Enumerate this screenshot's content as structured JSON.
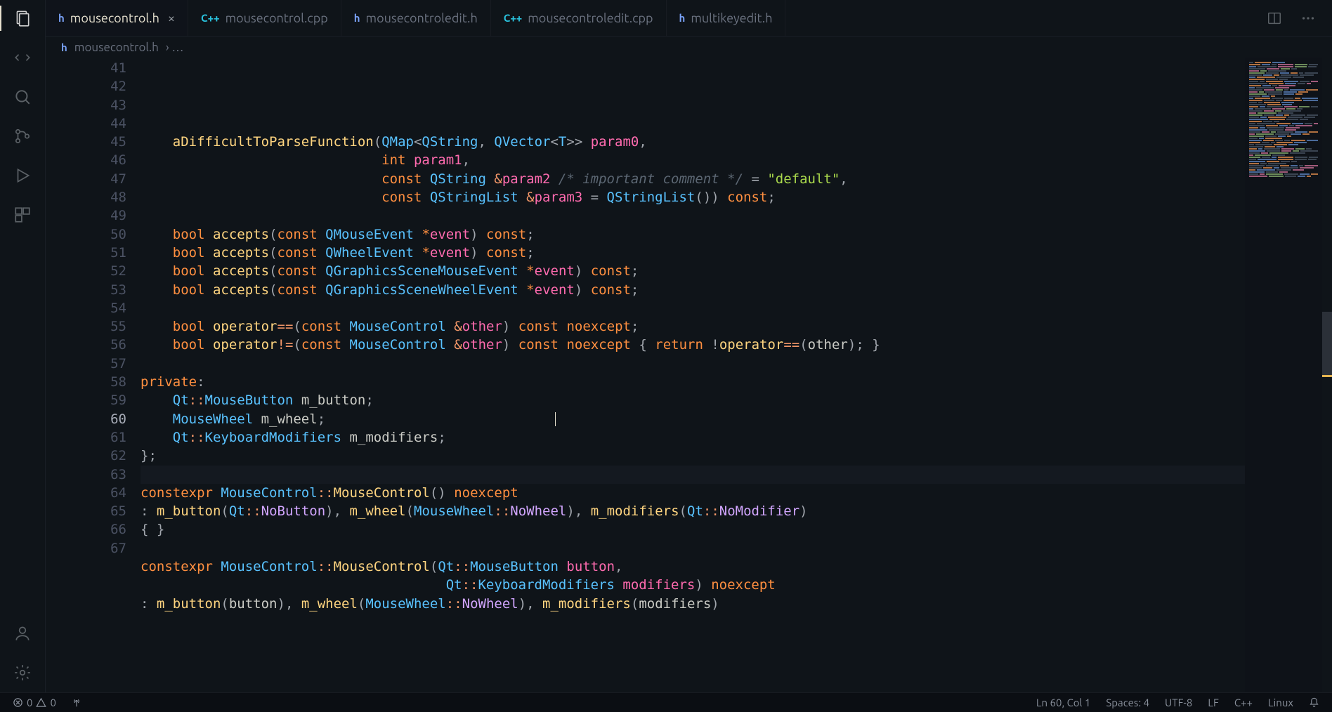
{
  "tabs": [
    {
      "lang": "h",
      "label": "mousecontrol.h",
      "active": true
    },
    {
      "lang": "cpp",
      "label": "mousecontrol.cpp",
      "active": false
    },
    {
      "lang": "h",
      "label": "mousecontroledit.h",
      "active": false
    },
    {
      "lang": "cpp",
      "label": "mousecontroledit.cpp",
      "active": false
    },
    {
      "lang": "h",
      "label": "multikeyedit.h",
      "active": false
    }
  ],
  "breadcrumb": {
    "lang": "h",
    "file": "mousecontrol.h",
    "rest": "› …"
  },
  "first_line_number": 41,
  "active_line_index": 19,
  "status": {
    "errors": "0",
    "warnings": "0",
    "lncol": "Ln 60, Col 1",
    "spaces": "Spaces: 4",
    "encoding": "UTF-8",
    "eol": "LF",
    "language": "C++",
    "os": "Linux"
  },
  "code_lines": [
    [
      [
        "    ",
        "plain"
      ]
    ],
    [
      [
        "    ",
        "plain"
      ],
      [
        "aDifficultToParseFunction",
        "s-func"
      ],
      [
        "(",
        "s-punc"
      ],
      [
        "QMap",
        "s-type"
      ],
      [
        "<",
        "s-punc"
      ],
      [
        "QString",
        "s-type"
      ],
      [
        ", ",
        "s-punc"
      ],
      [
        "QVector",
        "s-type"
      ],
      [
        "<",
        "s-punc"
      ],
      [
        "T",
        "s-type"
      ],
      [
        ">> ",
        "s-punc"
      ],
      [
        "param0",
        "s-param"
      ],
      [
        ",",
        "s-punc"
      ]
    ],
    [
      [
        "                              ",
        "plain"
      ],
      [
        "int",
        "s-kw"
      ],
      [
        " ",
        "plain"
      ],
      [
        "param1",
        "s-param"
      ],
      [
        ",",
        "s-punc"
      ]
    ],
    [
      [
        "                              ",
        "plain"
      ],
      [
        "const",
        "s-kw"
      ],
      [
        " ",
        "plain"
      ],
      [
        "QString",
        "s-type"
      ],
      [
        " ",
        "plain"
      ],
      [
        "&",
        "s-op"
      ],
      [
        "param2",
        "s-param"
      ],
      [
        " ",
        "plain"
      ],
      [
        "/* important comment */",
        "s-comment"
      ],
      [
        " = ",
        "s-punc"
      ],
      [
        "\"default\"",
        "s-str"
      ],
      [
        ",",
        "s-punc"
      ]
    ],
    [
      [
        "                              ",
        "plain"
      ],
      [
        "const",
        "s-kw"
      ],
      [
        " ",
        "plain"
      ],
      [
        "QStringList",
        "s-type"
      ],
      [
        " ",
        "plain"
      ],
      [
        "&",
        "s-op"
      ],
      [
        "param3",
        "s-param"
      ],
      [
        " = ",
        "s-punc"
      ],
      [
        "QStringList",
        "s-type"
      ],
      [
        "()) ",
        "s-punc"
      ],
      [
        "const",
        "s-kw"
      ],
      [
        ";",
        "s-punc"
      ]
    ],
    [
      [
        "",
        "plain"
      ]
    ],
    [
      [
        "    ",
        "plain"
      ],
      [
        "bool",
        "s-kw"
      ],
      [
        " ",
        "plain"
      ],
      [
        "accepts",
        "s-func"
      ],
      [
        "(",
        "s-punc"
      ],
      [
        "const",
        "s-kw"
      ],
      [
        " ",
        "plain"
      ],
      [
        "QMouseEvent",
        "s-type"
      ],
      [
        " ",
        "plain"
      ],
      [
        "*",
        "s-star"
      ],
      [
        "event",
        "s-param"
      ],
      [
        ") ",
        "s-punc"
      ],
      [
        "const",
        "s-kw"
      ],
      [
        ";",
        "s-punc"
      ]
    ],
    [
      [
        "    ",
        "plain"
      ],
      [
        "bool",
        "s-kw"
      ],
      [
        " ",
        "plain"
      ],
      [
        "accepts",
        "s-func"
      ],
      [
        "(",
        "s-punc"
      ],
      [
        "const",
        "s-kw"
      ],
      [
        " ",
        "plain"
      ],
      [
        "QWheelEvent",
        "s-type"
      ],
      [
        " ",
        "plain"
      ],
      [
        "*",
        "s-star"
      ],
      [
        "event",
        "s-param"
      ],
      [
        ") ",
        "s-punc"
      ],
      [
        "const",
        "s-kw"
      ],
      [
        ";",
        "s-punc"
      ]
    ],
    [
      [
        "    ",
        "plain"
      ],
      [
        "bool",
        "s-kw"
      ],
      [
        " ",
        "plain"
      ],
      [
        "accepts",
        "s-func"
      ],
      [
        "(",
        "s-punc"
      ],
      [
        "const",
        "s-kw"
      ],
      [
        " ",
        "plain"
      ],
      [
        "QGraphicsSceneMouseEvent",
        "s-type"
      ],
      [
        " ",
        "plain"
      ],
      [
        "*",
        "s-star"
      ],
      [
        "event",
        "s-param"
      ],
      [
        ") ",
        "s-punc"
      ],
      [
        "const",
        "s-kw"
      ],
      [
        ";",
        "s-punc"
      ]
    ],
    [
      [
        "    ",
        "plain"
      ],
      [
        "bool",
        "s-kw"
      ],
      [
        " ",
        "plain"
      ],
      [
        "accepts",
        "s-func"
      ],
      [
        "(",
        "s-punc"
      ],
      [
        "const",
        "s-kw"
      ],
      [
        " ",
        "plain"
      ],
      [
        "QGraphicsSceneWheelEvent",
        "s-type"
      ],
      [
        " ",
        "plain"
      ],
      [
        "*",
        "s-star"
      ],
      [
        "event",
        "s-param"
      ],
      [
        ") ",
        "s-punc"
      ],
      [
        "const",
        "s-kw"
      ],
      [
        ";",
        "s-punc"
      ]
    ],
    [
      [
        "",
        "plain"
      ]
    ],
    [
      [
        "    ",
        "plain"
      ],
      [
        "bool",
        "s-kw"
      ],
      [
        " ",
        "plain"
      ],
      [
        "operator",
        "s-func"
      ],
      [
        "==",
        "s-op"
      ],
      [
        "(",
        "s-punc"
      ],
      [
        "const",
        "s-kw"
      ],
      [
        " ",
        "plain"
      ],
      [
        "MouseControl",
        "s-type"
      ],
      [
        " ",
        "plain"
      ],
      [
        "&",
        "s-op"
      ],
      [
        "other",
        "s-param"
      ],
      [
        ") ",
        "s-punc"
      ],
      [
        "const",
        "s-kw"
      ],
      [
        " ",
        "plain"
      ],
      [
        "noexcept",
        "s-kw"
      ],
      [
        ";",
        "s-punc"
      ]
    ],
    [
      [
        "    ",
        "plain"
      ],
      [
        "bool",
        "s-kw"
      ],
      [
        " ",
        "plain"
      ],
      [
        "operator",
        "s-func"
      ],
      [
        "!=",
        "s-op"
      ],
      [
        "(",
        "s-punc"
      ],
      [
        "const",
        "s-kw"
      ],
      [
        " ",
        "plain"
      ],
      [
        "MouseControl",
        "s-type"
      ],
      [
        " ",
        "plain"
      ],
      [
        "&",
        "s-op"
      ],
      [
        "other",
        "s-param"
      ],
      [
        ") ",
        "s-punc"
      ],
      [
        "const",
        "s-kw"
      ],
      [
        " ",
        "plain"
      ],
      [
        "noexcept",
        "s-kw"
      ],
      [
        " { ",
        "s-punc"
      ],
      [
        "return",
        "s-kw"
      ],
      [
        " !",
        "s-punc"
      ],
      [
        "operator",
        "s-func"
      ],
      [
        "==",
        "s-op"
      ],
      [
        "(",
        "s-punc"
      ],
      [
        "other",
        "s-var"
      ],
      [
        "); }",
        "s-punc"
      ]
    ],
    [
      [
        "",
        "plain"
      ]
    ],
    [
      [
        "private",
        "s-kw"
      ],
      [
        ":",
        "s-punc"
      ]
    ],
    [
      [
        "    ",
        "plain"
      ],
      [
        "Qt",
        "s-type"
      ],
      [
        "::",
        "s-op"
      ],
      [
        "MouseButton",
        "s-type"
      ],
      [
        " ",
        "plain"
      ],
      [
        "m_button",
        "s-var"
      ],
      [
        ";",
        "s-punc"
      ]
    ],
    [
      [
        "    ",
        "plain"
      ],
      [
        "MouseWheel",
        "s-type"
      ],
      [
        " ",
        "plain"
      ],
      [
        "m_wheel",
        "s-var"
      ],
      [
        ";",
        "s-punc"
      ]
    ],
    [
      [
        "    ",
        "plain"
      ],
      [
        "Qt",
        "s-type"
      ],
      [
        "::",
        "s-op"
      ],
      [
        "KeyboardModifiers",
        "s-type"
      ],
      [
        " ",
        "plain"
      ],
      [
        "m_modifiers",
        "s-var"
      ],
      [
        ";",
        "s-punc"
      ]
    ],
    [
      [
        "};",
        "s-punc"
      ]
    ],
    [
      [
        "",
        "plain"
      ]
    ],
    [
      [
        "constexpr",
        "s-kw"
      ],
      [
        " ",
        "plain"
      ],
      [
        "MouseControl",
        "s-type"
      ],
      [
        "::",
        "s-op"
      ],
      [
        "MouseControl",
        "s-func"
      ],
      [
        "() ",
        "s-punc"
      ],
      [
        "noexcept",
        "s-kw"
      ]
    ],
    [
      [
        ": ",
        "s-punc"
      ],
      [
        "m_button",
        "s-func"
      ],
      [
        "(",
        "s-punc"
      ],
      [
        "Qt",
        "s-type"
      ],
      [
        "::",
        "s-op"
      ],
      [
        "NoButton",
        "s-enum"
      ],
      [
        "), ",
        "s-punc"
      ],
      [
        "m_wheel",
        "s-func"
      ],
      [
        "(",
        "s-punc"
      ],
      [
        "MouseWheel",
        "s-type"
      ],
      [
        "::",
        "s-op"
      ],
      [
        "NoWheel",
        "s-enum"
      ],
      [
        "), ",
        "s-punc"
      ],
      [
        "m_modifiers",
        "s-func"
      ],
      [
        "(",
        "s-punc"
      ],
      [
        "Qt",
        "s-type"
      ],
      [
        "::",
        "s-op"
      ],
      [
        "NoModifier",
        "s-enum"
      ],
      [
        ")",
        "s-punc"
      ]
    ],
    [
      [
        "{ }",
        "s-punc"
      ]
    ],
    [
      [
        "",
        "plain"
      ]
    ],
    [
      [
        "constexpr",
        "s-kw"
      ],
      [
        " ",
        "plain"
      ],
      [
        "MouseControl",
        "s-type"
      ],
      [
        "::",
        "s-op"
      ],
      [
        "MouseControl",
        "s-func"
      ],
      [
        "(",
        "s-punc"
      ],
      [
        "Qt",
        "s-type"
      ],
      [
        "::",
        "s-op"
      ],
      [
        "MouseButton",
        "s-type"
      ],
      [
        " ",
        "plain"
      ],
      [
        "button",
        "s-param"
      ],
      [
        ",",
        "s-punc"
      ]
    ],
    [
      [
        "                                      ",
        "plain"
      ],
      [
        "Qt",
        "s-type"
      ],
      [
        "::",
        "s-op"
      ],
      [
        "KeyboardModifiers",
        "s-type"
      ],
      [
        " ",
        "plain"
      ],
      [
        "modifiers",
        "s-param"
      ],
      [
        ") ",
        "s-punc"
      ],
      [
        "noexcept",
        "s-kw"
      ]
    ],
    [
      [
        ": ",
        "s-punc"
      ],
      [
        "m_button",
        "s-func"
      ],
      [
        "(",
        "s-punc"
      ],
      [
        "button",
        "s-var"
      ],
      [
        "), ",
        "s-punc"
      ],
      [
        "m_wheel",
        "s-func"
      ],
      [
        "(",
        "s-punc"
      ],
      [
        "MouseWheel",
        "s-type"
      ],
      [
        "::",
        "s-op"
      ],
      [
        "NoWheel",
        "s-enum"
      ],
      [
        "), ",
        "s-punc"
      ],
      [
        "m_modifiers",
        "s-func"
      ],
      [
        "(",
        "s-punc"
      ],
      [
        "modifiers",
        "s-var"
      ],
      [
        ")",
        "s-punc"
      ]
    ]
  ]
}
